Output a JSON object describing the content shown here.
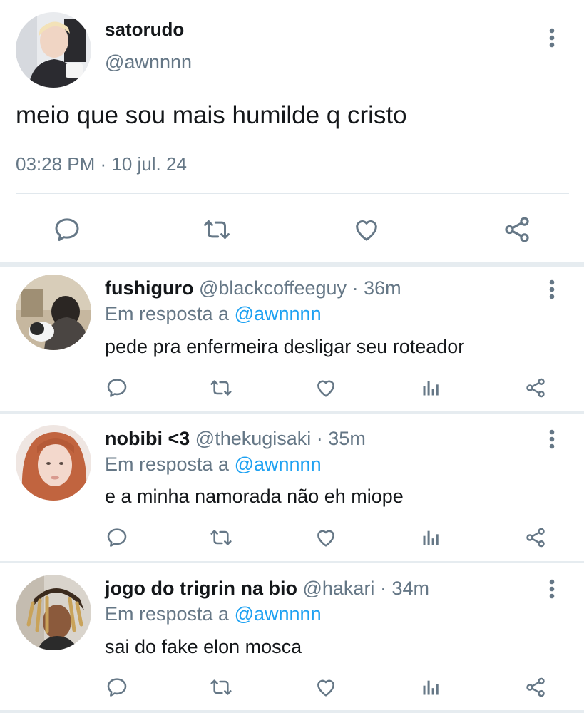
{
  "main_tweet": {
    "name": "satorudo",
    "handle": "@awnnnn",
    "text": "meio que sou mais humilde q cristo",
    "timestamp": "03:28 PM · 10 jul. 24",
    "actions": [
      "reply-icon",
      "retweet-icon",
      "like-icon",
      "share-icon"
    ]
  },
  "replies": [
    {
      "name": "fushiguro",
      "handle": "@blackcoffeeguy",
      "time": "· 36m",
      "reply_prefix": "Em resposta a",
      "reply_to": "@awnnnn",
      "text": "pede pra enfermeira desligar seu roteador"
    },
    {
      "name": "nobibi <3",
      "handle": "@thekugisaki",
      "time": "· 35m",
      "reply_prefix": "Em resposta a",
      "reply_to": "@awnnnn",
      "text": "e a minha namorada não eh miope"
    },
    {
      "name": "jogo do trigrin na bio",
      "handle": "@hakari",
      "time": "· 34m",
      "reply_prefix": "Em resposta a",
      "reply_to": "@awnnnn",
      "text": "sai do fake elon mosca"
    }
  ],
  "colors": {
    "text": "#14171a",
    "secondary": "#657786",
    "link": "#1da1f2",
    "divider": "#e6ecf0"
  }
}
